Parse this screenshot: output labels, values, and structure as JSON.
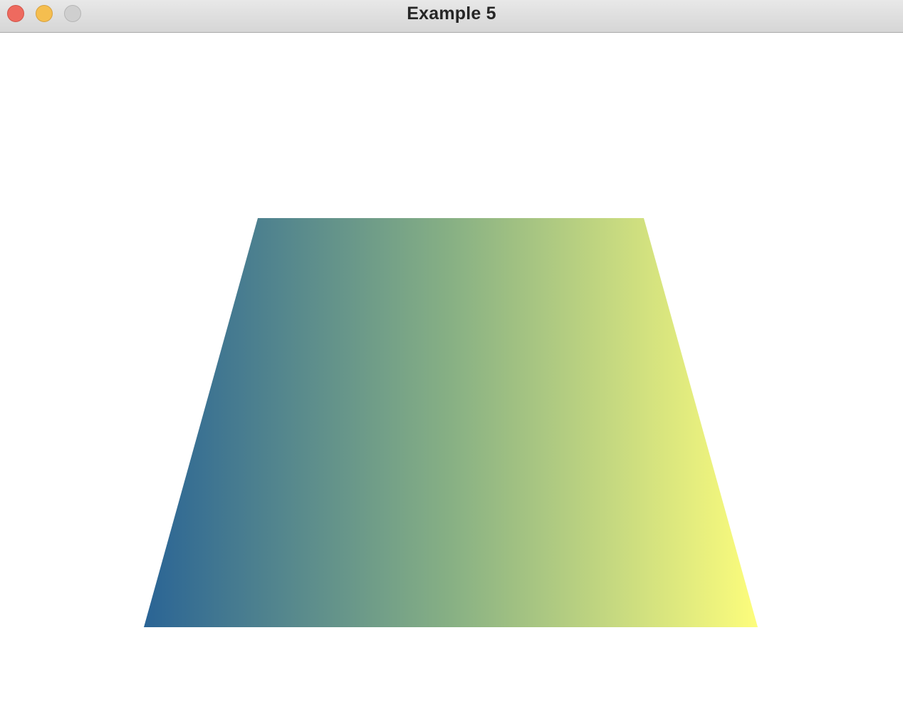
{
  "window": {
    "title": "Example 5",
    "controls": {
      "close": "close-button",
      "minimize": "minimize-button",
      "zoom": "zoom-button"
    }
  },
  "canvas": {
    "shape": "trapezoid",
    "fill_gradient": {
      "start_color": "#2a6495",
      "mid_color": "#87b084",
      "end_color": "#fdfd7c"
    }
  },
  "colors": {
    "close": "#ee6a5f",
    "minimize": "#f5be4f",
    "zoom": "#cfcfcf",
    "background": "#ffffff"
  }
}
